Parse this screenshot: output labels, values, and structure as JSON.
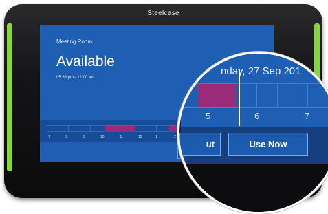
{
  "device": {
    "brand": "Steelcase"
  },
  "screen": {
    "room_name": "Meeting Room",
    "status": "Available",
    "time_range": "05:36 pm - 12:00 am",
    "timeline_hours": [
      "7",
      "8",
      "9",
      "10",
      "11",
      "12",
      "1",
      "2"
    ]
  },
  "magnifier": {
    "date_partial": "nday, 27 Sep 201",
    "hours": [
      "5",
      "6",
      "7"
    ],
    "buttons": {
      "out_partial": "ut",
      "use_now": "Use Now"
    }
  },
  "colors": {
    "screen_blue": "#1f5fb3",
    "booked": "#9a2a7a",
    "accent_green": "#86d83a"
  }
}
